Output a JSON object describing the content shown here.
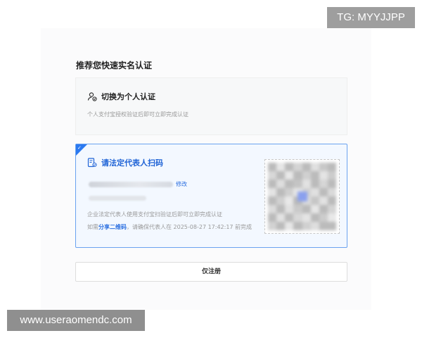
{
  "watermark": {
    "tg": "TG: MYYJJPP",
    "url": "www.useraomendc.com"
  },
  "page": {
    "title": "推荐您快速实名认证"
  },
  "personal_card": {
    "title": "切换为个人认证",
    "description": "个人支付宝授权验证后即可立即完成认证",
    "icon": "user-switch-icon"
  },
  "corp_card": {
    "title": "请法定代表人扫码",
    "icon": "scan-id-icon",
    "edit_label": "修改",
    "description": "企业法定代表人使用支付宝扫验证后即可立即完成认证",
    "share_prefix": "如需",
    "share_link": "分享二维码",
    "share_suffix": "，请确保代表人在 2025-08-27 17:42:17 前完成",
    "accent": "#2b79f0"
  },
  "actions": {
    "register_only": "仅注册"
  }
}
